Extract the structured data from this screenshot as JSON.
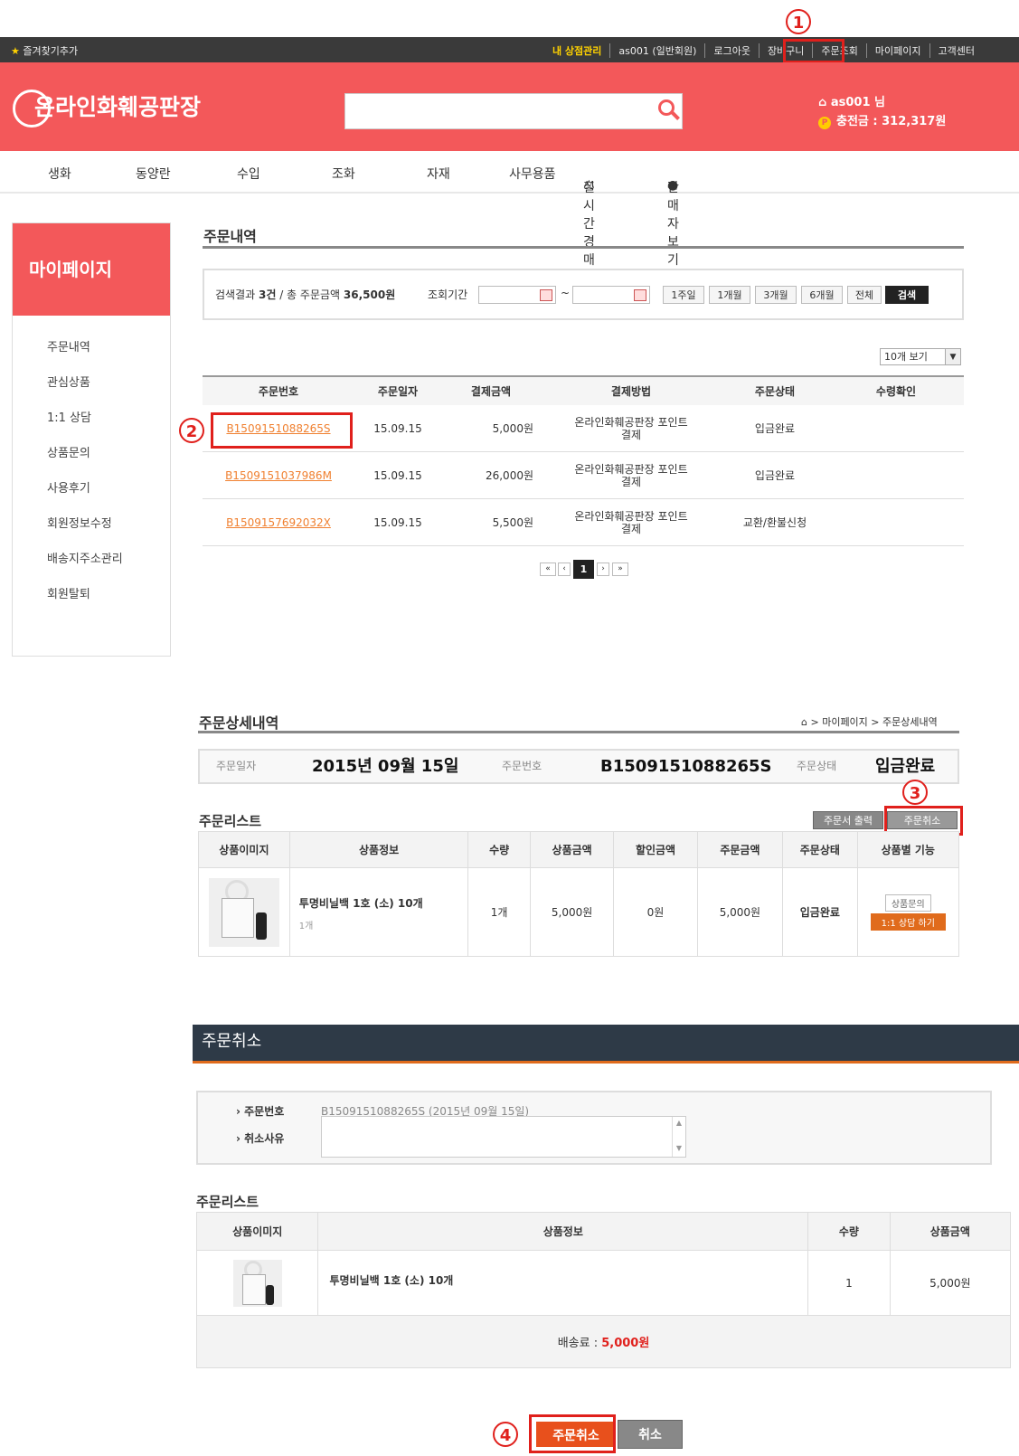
{
  "topbar": {
    "favorite": "즐겨찾기추가",
    "links": [
      "내 상점관리",
      "as001 (일반회원)",
      "로그아웃",
      "장바구니",
      "주문조회",
      "마이페이지",
      "고객센터"
    ]
  },
  "header": {
    "logo": "온라인화훼공판장",
    "user": "as001 님",
    "points": "충전금 : 312,317원"
  },
  "nav": [
    "생화",
    "동양란",
    "수입",
    "조화",
    "자재",
    "사무용품",
    "실시간경매",
    "판매자보기"
  ],
  "sidebar": {
    "title": "마이페이지",
    "items": [
      "주문내역",
      "관심상품",
      "1:1 상담",
      "상품문의",
      "사용후기",
      "회원정보수정",
      "배송지주소관리",
      "회원탈퇴"
    ]
  },
  "orders": {
    "title": "주문내역",
    "summary_prefix": "검색결과 ",
    "summary_count": "3건",
    "summary_mid": " / 총 주문금액 ",
    "summary_total": "36,500원",
    "period_label": "조회기간",
    "tilde": "~",
    "ranges": [
      "1주일",
      "1개월",
      "3개월",
      "6개월",
      "전체"
    ],
    "search_btn": "검색",
    "page_size": "10개 보기",
    "headers": [
      "주문번호",
      "주문일자",
      "결제금액",
      "결제방법",
      "주문상태",
      "수령확인"
    ],
    "rows": [
      {
        "no": "B1509151088265S",
        "date": "15.09.15",
        "amount": "5,000원",
        "method_1": "온라인화훼공판장 포인트",
        "method_2": "결제",
        "status": "입금완료"
      },
      {
        "no": "B1509151037986M",
        "date": "15.09.15",
        "amount": "26,000원",
        "method_1": "온라인화훼공판장 포인트",
        "method_2": "결제",
        "status": "입금완료"
      },
      {
        "no": "B1509157692032X",
        "date": "15.09.15",
        "amount": "5,500원",
        "method_1": "온라인화훼공판장 포인트",
        "method_2": "결제",
        "status": "교환/환불신청"
      }
    ],
    "pager": [
      "«",
      "‹",
      "1",
      "›",
      "»"
    ]
  },
  "detail": {
    "title": "주문상세내역",
    "breadcrumb": "> 마이페이지 > 주문상세내역",
    "breadcrumb_last": "주문상세내역",
    "date_label": "주문일자",
    "date": "2015년 09월 15일",
    "no_label": "주문번호",
    "no": "B1509151088265S",
    "status_label": "주문상태",
    "status": "입금완료",
    "list_title": "주문리스트",
    "print_btn": "주문서 출력",
    "cancel_btn": "주문취소",
    "headers": [
      "상품이미지",
      "상품정보",
      "수량",
      "상품금액",
      "할인금액",
      "주문금액",
      "주문상태",
      "상품별 기능"
    ],
    "item": {
      "name": "투명비닐백 1호 (소) 10개",
      "sub": "1개",
      "qty": "1개",
      "price": "5,000원",
      "discount": "0원",
      "total": "5,000원",
      "status": "입금완료",
      "inquiry_btn": "상품문의",
      "consult_btn": "1:1 상담 하기"
    }
  },
  "cancel": {
    "title": "주문취소",
    "no_label": "주문번호",
    "no_value": "B1509151088265S (2015년 09월 15일)",
    "reason_label": "취소사유",
    "list_title": "주문리스트",
    "headers": [
      "상품이미지",
      "상품정보",
      "수량",
      "상품금액"
    ],
    "item": {
      "name": "투명비닐백 1호 (소) 10개",
      "qty": "1",
      "price": "5,000원"
    },
    "shipping_label": "배송료 : ",
    "shipping_value": "5,000원",
    "confirm_btn": "주문취소",
    "back_btn": "취소"
  },
  "steps": [
    "1",
    "2",
    "3",
    "4"
  ],
  "colors": {
    "brand": "#f3585a",
    "accent": "#e06b1c",
    "highlight": "#e0201c"
  }
}
